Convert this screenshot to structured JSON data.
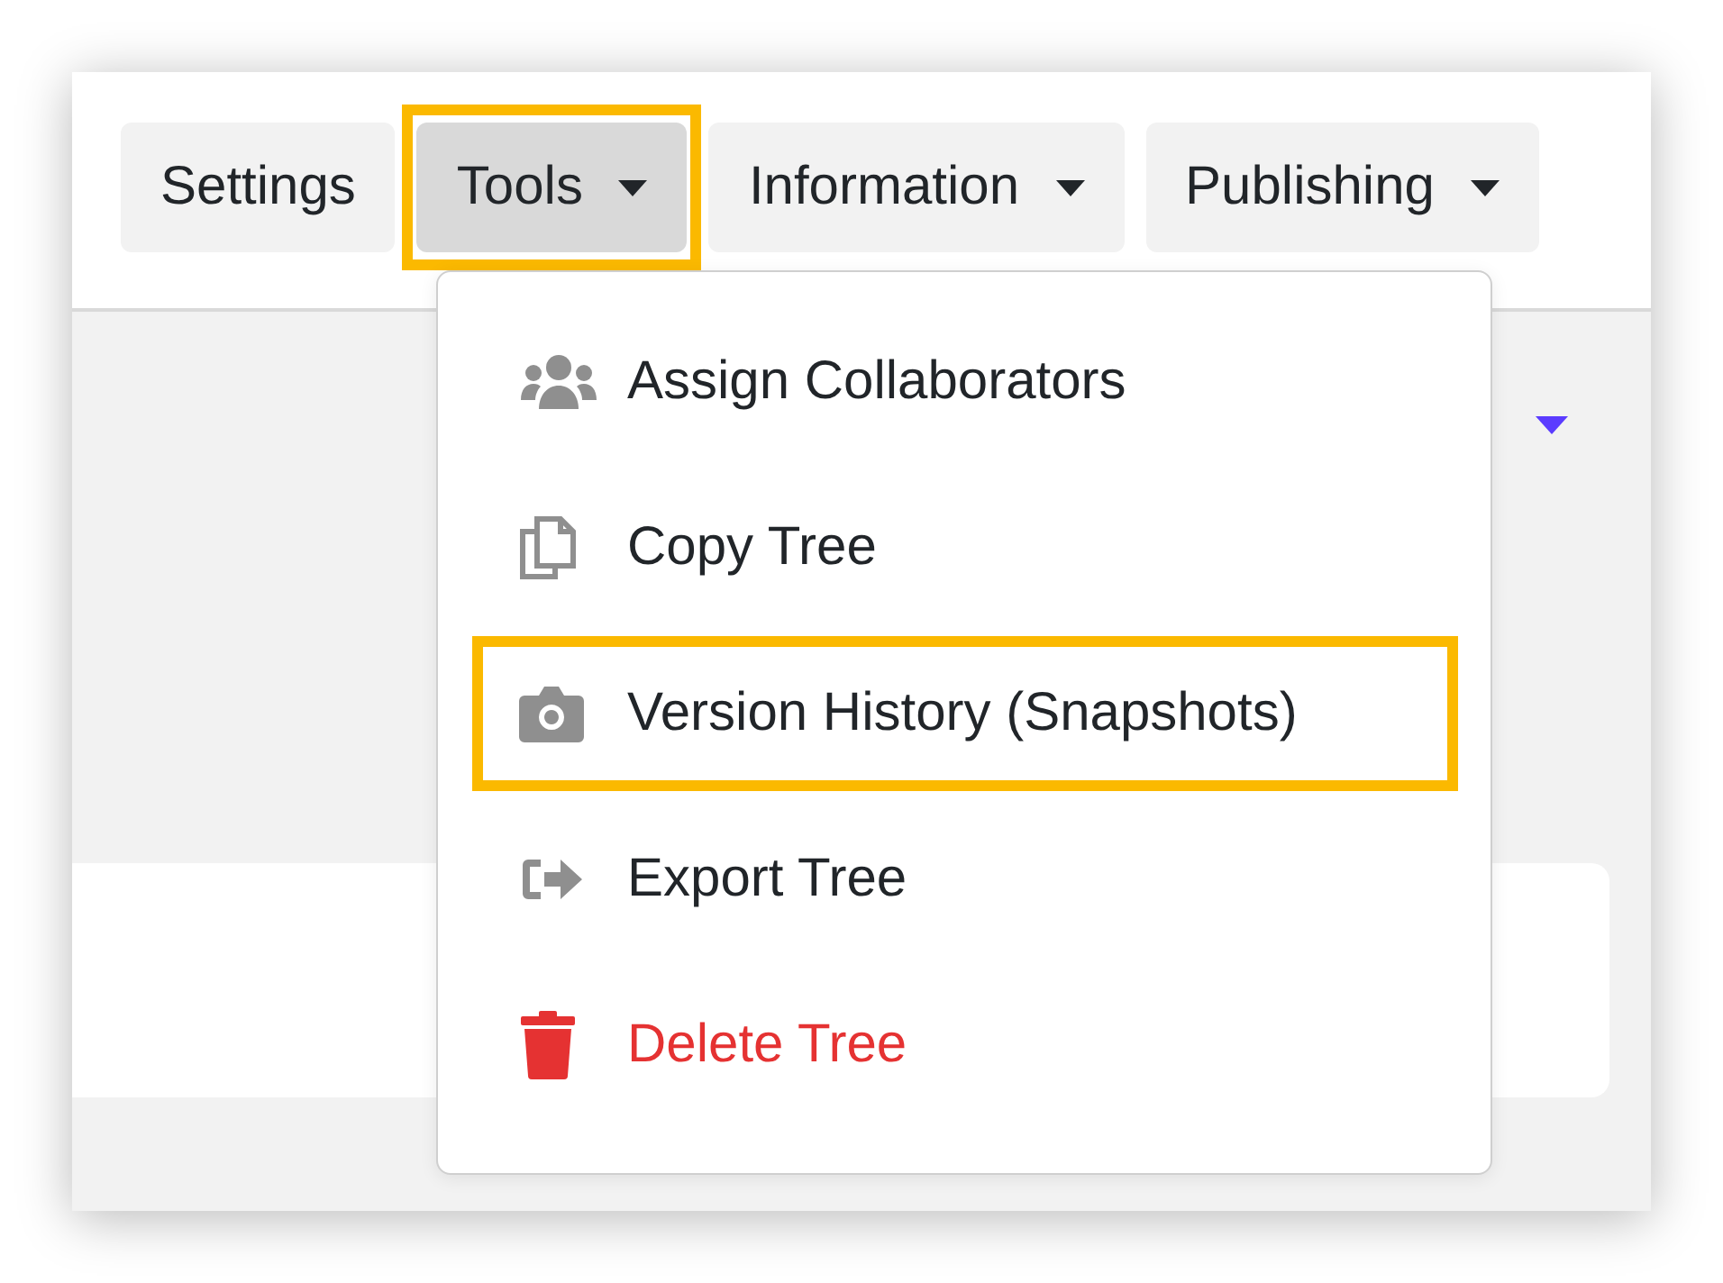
{
  "toolbar": {
    "buttons": [
      {
        "label": "Settings",
        "has_menu": false,
        "selected": false,
        "highlighted": false
      },
      {
        "label": "Tools",
        "has_menu": true,
        "selected": true,
        "highlighted": true
      },
      {
        "label": "Information",
        "has_menu": true,
        "selected": false,
        "highlighted": false
      },
      {
        "label": "Publishing",
        "has_menu": true,
        "selected": false,
        "highlighted": false
      }
    ]
  },
  "dropdown_menu": {
    "items": [
      {
        "label": "Assign Collaborators",
        "kind": "normal",
        "highlighted": false
      },
      {
        "label": "Copy Tree",
        "kind": "normal",
        "highlighted": false
      },
      {
        "label": "Version History (Snapshots)",
        "kind": "normal",
        "highlighted": true
      },
      {
        "label": "Export Tree",
        "kind": "normal",
        "highlighted": false
      },
      {
        "label": "Delete Tree",
        "kind": "danger",
        "highlighted": false
      }
    ]
  }
}
